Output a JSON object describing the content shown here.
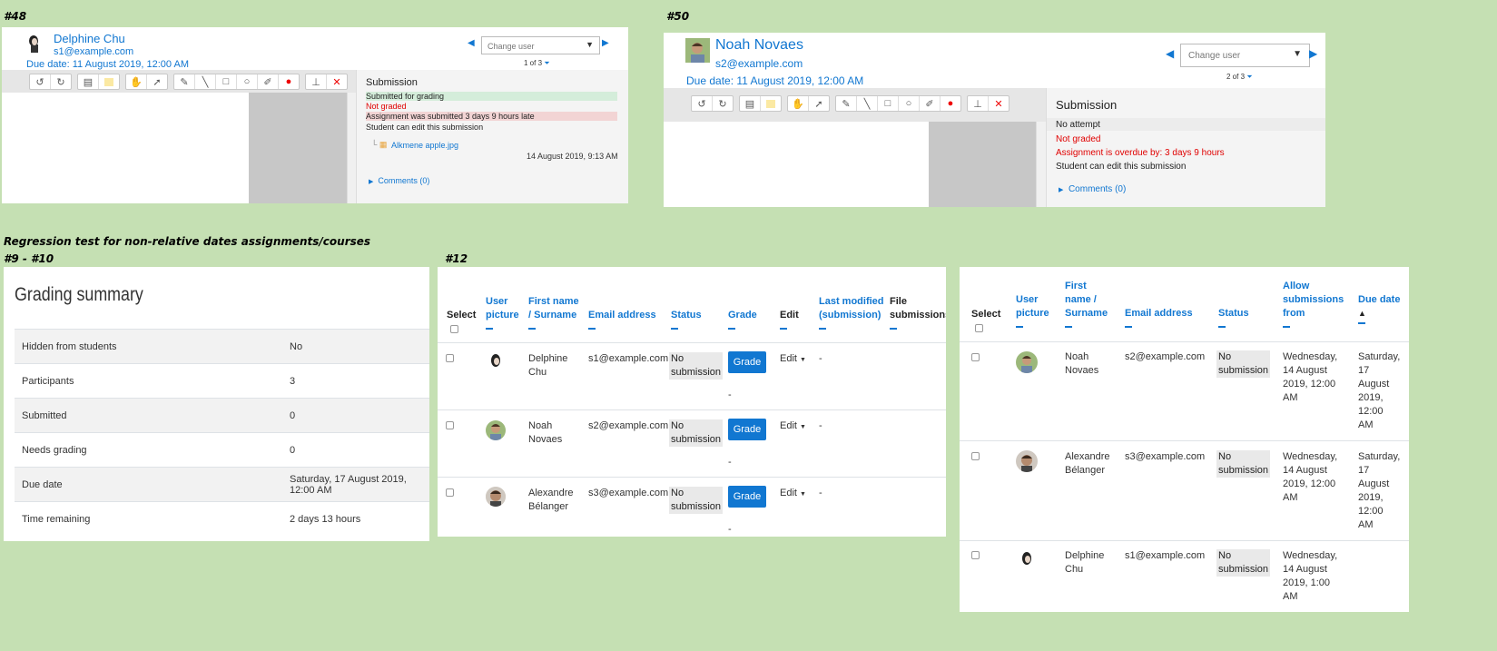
{
  "labels": {
    "p48": "#48",
    "p50": "#50",
    "regression": "Regression test for non-relative dates assignments/courses",
    "p9_10": "#9 - #10",
    "p12": "#12"
  },
  "panel48": {
    "user_name": "Delphine Chu",
    "email": "s1@example.com",
    "due_date": "Due date: 11 August 2019, 12:00 AM",
    "change_user_placeholder": "Change user",
    "pager": "1 of 3",
    "submission_title": "Submission",
    "status_submitted": "Submitted for grading",
    "status_not_graded": "Not graded",
    "status_late": "Assignment was submitted 3 days 9 hours late",
    "status_edit": "Student can edit this submission",
    "file_name": "Alkmene apple.jpg",
    "file_date": "14 August 2019, 9:13 AM",
    "comments": "Comments (0)"
  },
  "panel50": {
    "user_name": "Noah Novaes",
    "email": "s2@example.com",
    "due_date": "Due date: 11 August 2019, 12:00 AM",
    "change_user_placeholder": "Change user",
    "pager": "2 of 3",
    "submission_title": "Submission",
    "status_no_attempt": "No attempt",
    "status_not_graded": "Not graded",
    "status_overdue": "Assignment is overdue by: 3 days 9 hours",
    "status_edit": "Student can edit this submission",
    "comments": "Comments (0)"
  },
  "grading_summary": {
    "title": "Grading summary",
    "rows": [
      {
        "key": "Hidden from students",
        "value": "No"
      },
      {
        "key": "Participants",
        "value": "3"
      },
      {
        "key": "Submitted",
        "value": "0"
      },
      {
        "key": "Needs grading",
        "value": "0"
      },
      {
        "key": "Due date",
        "value": "Saturday, 17 August 2019, 12:00 AM"
      },
      {
        "key": "Time remaining",
        "value": "2 days 13 hours"
      }
    ]
  },
  "table12": {
    "headers": {
      "select": "Select",
      "user_picture_1": "User",
      "user_picture_2": "picture",
      "name_1": "First name",
      "name_2": "/ Surname",
      "email": "Email address",
      "status": "Status",
      "grade": "Grade",
      "edit": "Edit",
      "modified_1": "Last modified",
      "modified_2": "(submission)",
      "files_1": "File",
      "files_2": "submissions"
    },
    "rows": [
      {
        "first": "Delphine",
        "last": "Chu",
        "email": "s1@example.com",
        "status_1": "No",
        "status_2": "submission",
        "grade": "Grade",
        "edit": "Edit",
        "modified": "-",
        "below": "-"
      },
      {
        "first": "Noah",
        "last": "Novaes",
        "email": "s2@example.com",
        "status_1": "No",
        "status_2": "submission",
        "grade": "Grade",
        "edit": "Edit",
        "modified": "-",
        "below": "-"
      },
      {
        "first": "Alexandre",
        "last": "Bélanger",
        "email": "s3@example.com",
        "status_1": "No",
        "status_2": "submission",
        "grade": "Grade",
        "edit": "Edit",
        "modified": "-",
        "below": "-"
      }
    ]
  },
  "table_right": {
    "headers": {
      "select": "Select",
      "user_picture_1": "User",
      "user_picture_2": "picture",
      "name_1": "First",
      "name_2": "name /",
      "name_3": "Surname",
      "email": "Email address",
      "status": "Status",
      "allow_1": "Allow",
      "allow_2": "submissions",
      "allow_3": "from",
      "due": "Due date"
    },
    "rows": [
      {
        "first": "Noah",
        "last": "Novaes",
        "email": "s2@example.com",
        "status_1": "No",
        "status_2": "submission",
        "allow": [
          "Wednesday,",
          "14 August",
          "2019, 12:00",
          "AM"
        ],
        "due": [
          "Saturday,",
          "17",
          "August",
          "2019,",
          "12:00",
          "AM"
        ]
      },
      {
        "first": "Alexandre",
        "last": "Bélanger",
        "email": "s3@example.com",
        "status_1": "No",
        "status_2": "submission",
        "allow": [
          "Wednesday,",
          "14 August",
          "2019, 12:00",
          "AM"
        ],
        "due": [
          "Saturday,",
          "17",
          "August",
          "2019,",
          "12:00",
          "AM"
        ]
      },
      {
        "first": "Delphine",
        "last": "Chu",
        "email": "s1@example.com",
        "status_1": "No",
        "status_2": "submission",
        "allow": [
          "Wednesday,",
          "14 August",
          "2019, 1:00",
          "AM"
        ],
        "due": []
      }
    ]
  },
  "colors": {
    "background": "#c5e0b3",
    "link": "#1177d1",
    "success_bg": "#d4edda",
    "danger_bg": "#f2d4d4",
    "danger_text": "#e00000"
  },
  "icons": [
    "undo-icon",
    "redo-icon",
    "comment-icon",
    "highlight-icon",
    "pan-icon",
    "select-icon",
    "pen-icon",
    "line-icon",
    "rectangle-icon",
    "oval-icon",
    "brush-icon",
    "color-icon",
    "stamp-icon",
    "delete-icon",
    "filter-icon",
    "chevron-left-icon",
    "chevron-right-icon",
    "caret-down-icon"
  ]
}
